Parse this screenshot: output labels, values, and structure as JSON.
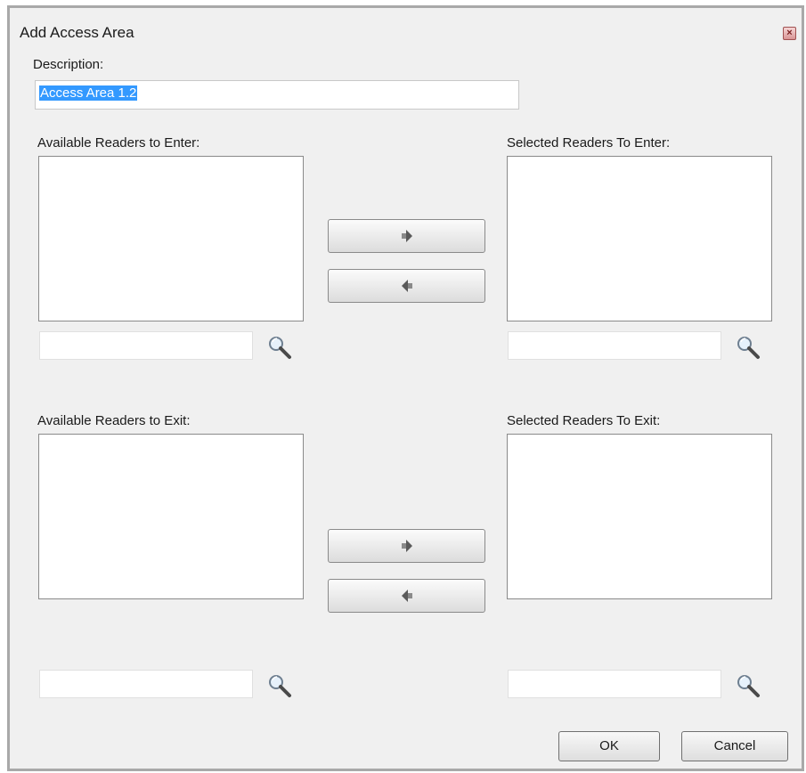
{
  "window": {
    "title": "Add Access Area",
    "close_glyph": "×"
  },
  "description": {
    "label": "Description:",
    "value": "Access Area 1.2"
  },
  "enter": {
    "available_label": "Available Readers to Enter:",
    "selected_label": "Selected Readers To Enter:",
    "available_filter_value": "",
    "selected_filter_value": ""
  },
  "exit": {
    "available_label": "Available Readers to Exit:",
    "selected_label": "Selected Readers To Exit:",
    "available_filter_value": "",
    "selected_filter_value": ""
  },
  "icons": {
    "add": "arrow-right-icon",
    "remove": "arrow-left-icon",
    "search": "magnifier-icon"
  },
  "buttons": {
    "ok": "OK",
    "cancel": "Cancel"
  },
  "colors": {
    "selection": "#3399ff",
    "frame": "#a9a9a9",
    "window_bg": "#f0f0f0"
  }
}
